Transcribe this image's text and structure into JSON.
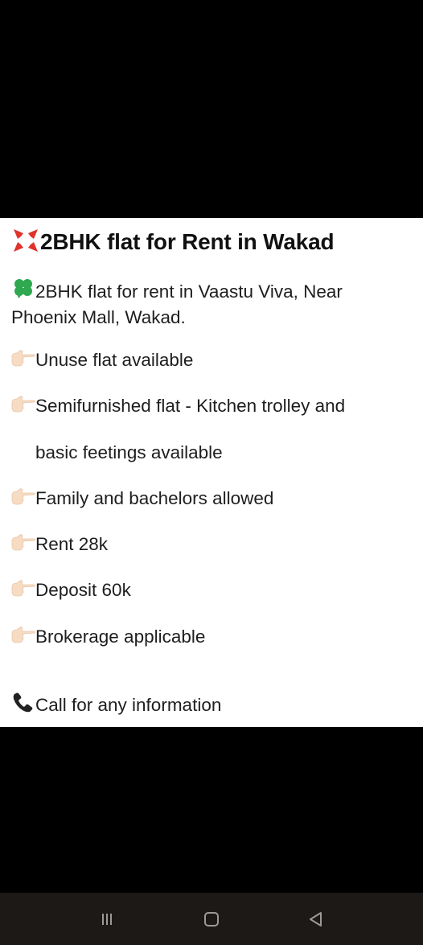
{
  "post": {
    "title": "2BHK flat for Rent in Wakad",
    "intro_line1": "2BHK flat for rent in Vaastu Viva, Near",
    "intro_line2": "Phoenix Mall, Wakad.",
    "bullets": [
      "Unuse flat available",
      "Semifurnished flat - Kitchen trolley and",
      "basic feetings available",
      "Family and bachelors allowed",
      "Rent 28k",
      "Deposit 60k",
      "Brokerage applicable"
    ],
    "call_text": "Call for any information"
  },
  "icons": {
    "title_icon": "anger-symbol-icon",
    "intro_icon": "shamrock-icon",
    "bullet_icon": "pointing-hand-icon",
    "call_icon": "telephone-icon"
  },
  "navbar": {
    "recent_icon": "recent-apps-icon",
    "home_icon": "home-icon",
    "back_icon": "back-icon"
  },
  "colors": {
    "anger_symbol": "#e0332b",
    "shamrock": "#2fa84f",
    "hand_skin": "#f7dcc4",
    "background": "#000000",
    "card": "#ffffff",
    "navbar": "#1c1917"
  }
}
